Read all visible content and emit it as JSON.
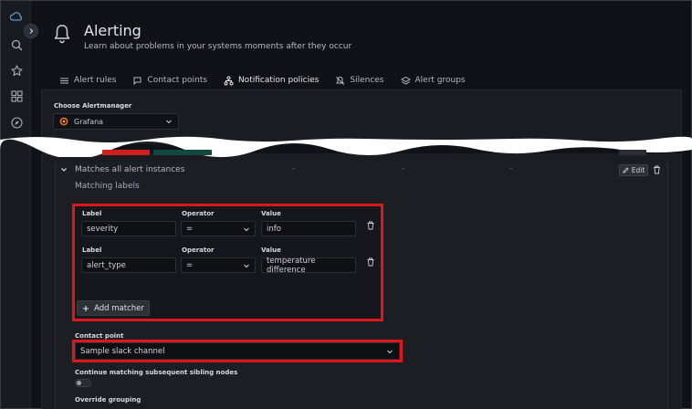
{
  "header": {
    "title": "Alerting",
    "subtitle": "Learn about problems in your systems moments after they occur"
  },
  "nav": {
    "icons": [
      "grafana-logo-icon",
      "search-icon",
      "star-icon",
      "dashboards-icon",
      "explore-icon"
    ]
  },
  "tabs": [
    {
      "label": "Alert rules",
      "icon": "list-icon",
      "active": false
    },
    {
      "label": "Contact points",
      "icon": "comment-alt-share-icon",
      "active": false
    },
    {
      "label": "Notification policies",
      "icon": "sitemap-icon",
      "active": true
    },
    {
      "label": "Silences",
      "icon": "bell-slash-icon",
      "active": false
    },
    {
      "label": "Alert groups",
      "icon": "layer-group-icon",
      "active": false
    }
  ],
  "alertmanager": {
    "label": "Choose Alertmanager",
    "value": "Grafana"
  },
  "policy": {
    "toggle_label": "Matches all alert instances",
    "dashes": [
      "-",
      "-",
      "-"
    ],
    "edit_label": "Edit",
    "matching_labels": "Matching labels"
  },
  "matchers": {
    "headers": {
      "label": "Label",
      "operator": "Operator",
      "value": "Value"
    },
    "rows": [
      {
        "label": "severity",
        "operator": "=",
        "value": "info"
      },
      {
        "label": "alert_type",
        "operator": "=",
        "value": "temperature difference"
      }
    ],
    "add_label": "Add matcher"
  },
  "contact_point": {
    "label": "Contact point",
    "value": "Sample slack channel"
  },
  "continue_label": "Continue matching subsequent sibling nodes",
  "override_label": "Override grouping",
  "colors": {
    "accent": "#f46b26",
    "highlight": "#e0161b",
    "background": "#111217"
  }
}
